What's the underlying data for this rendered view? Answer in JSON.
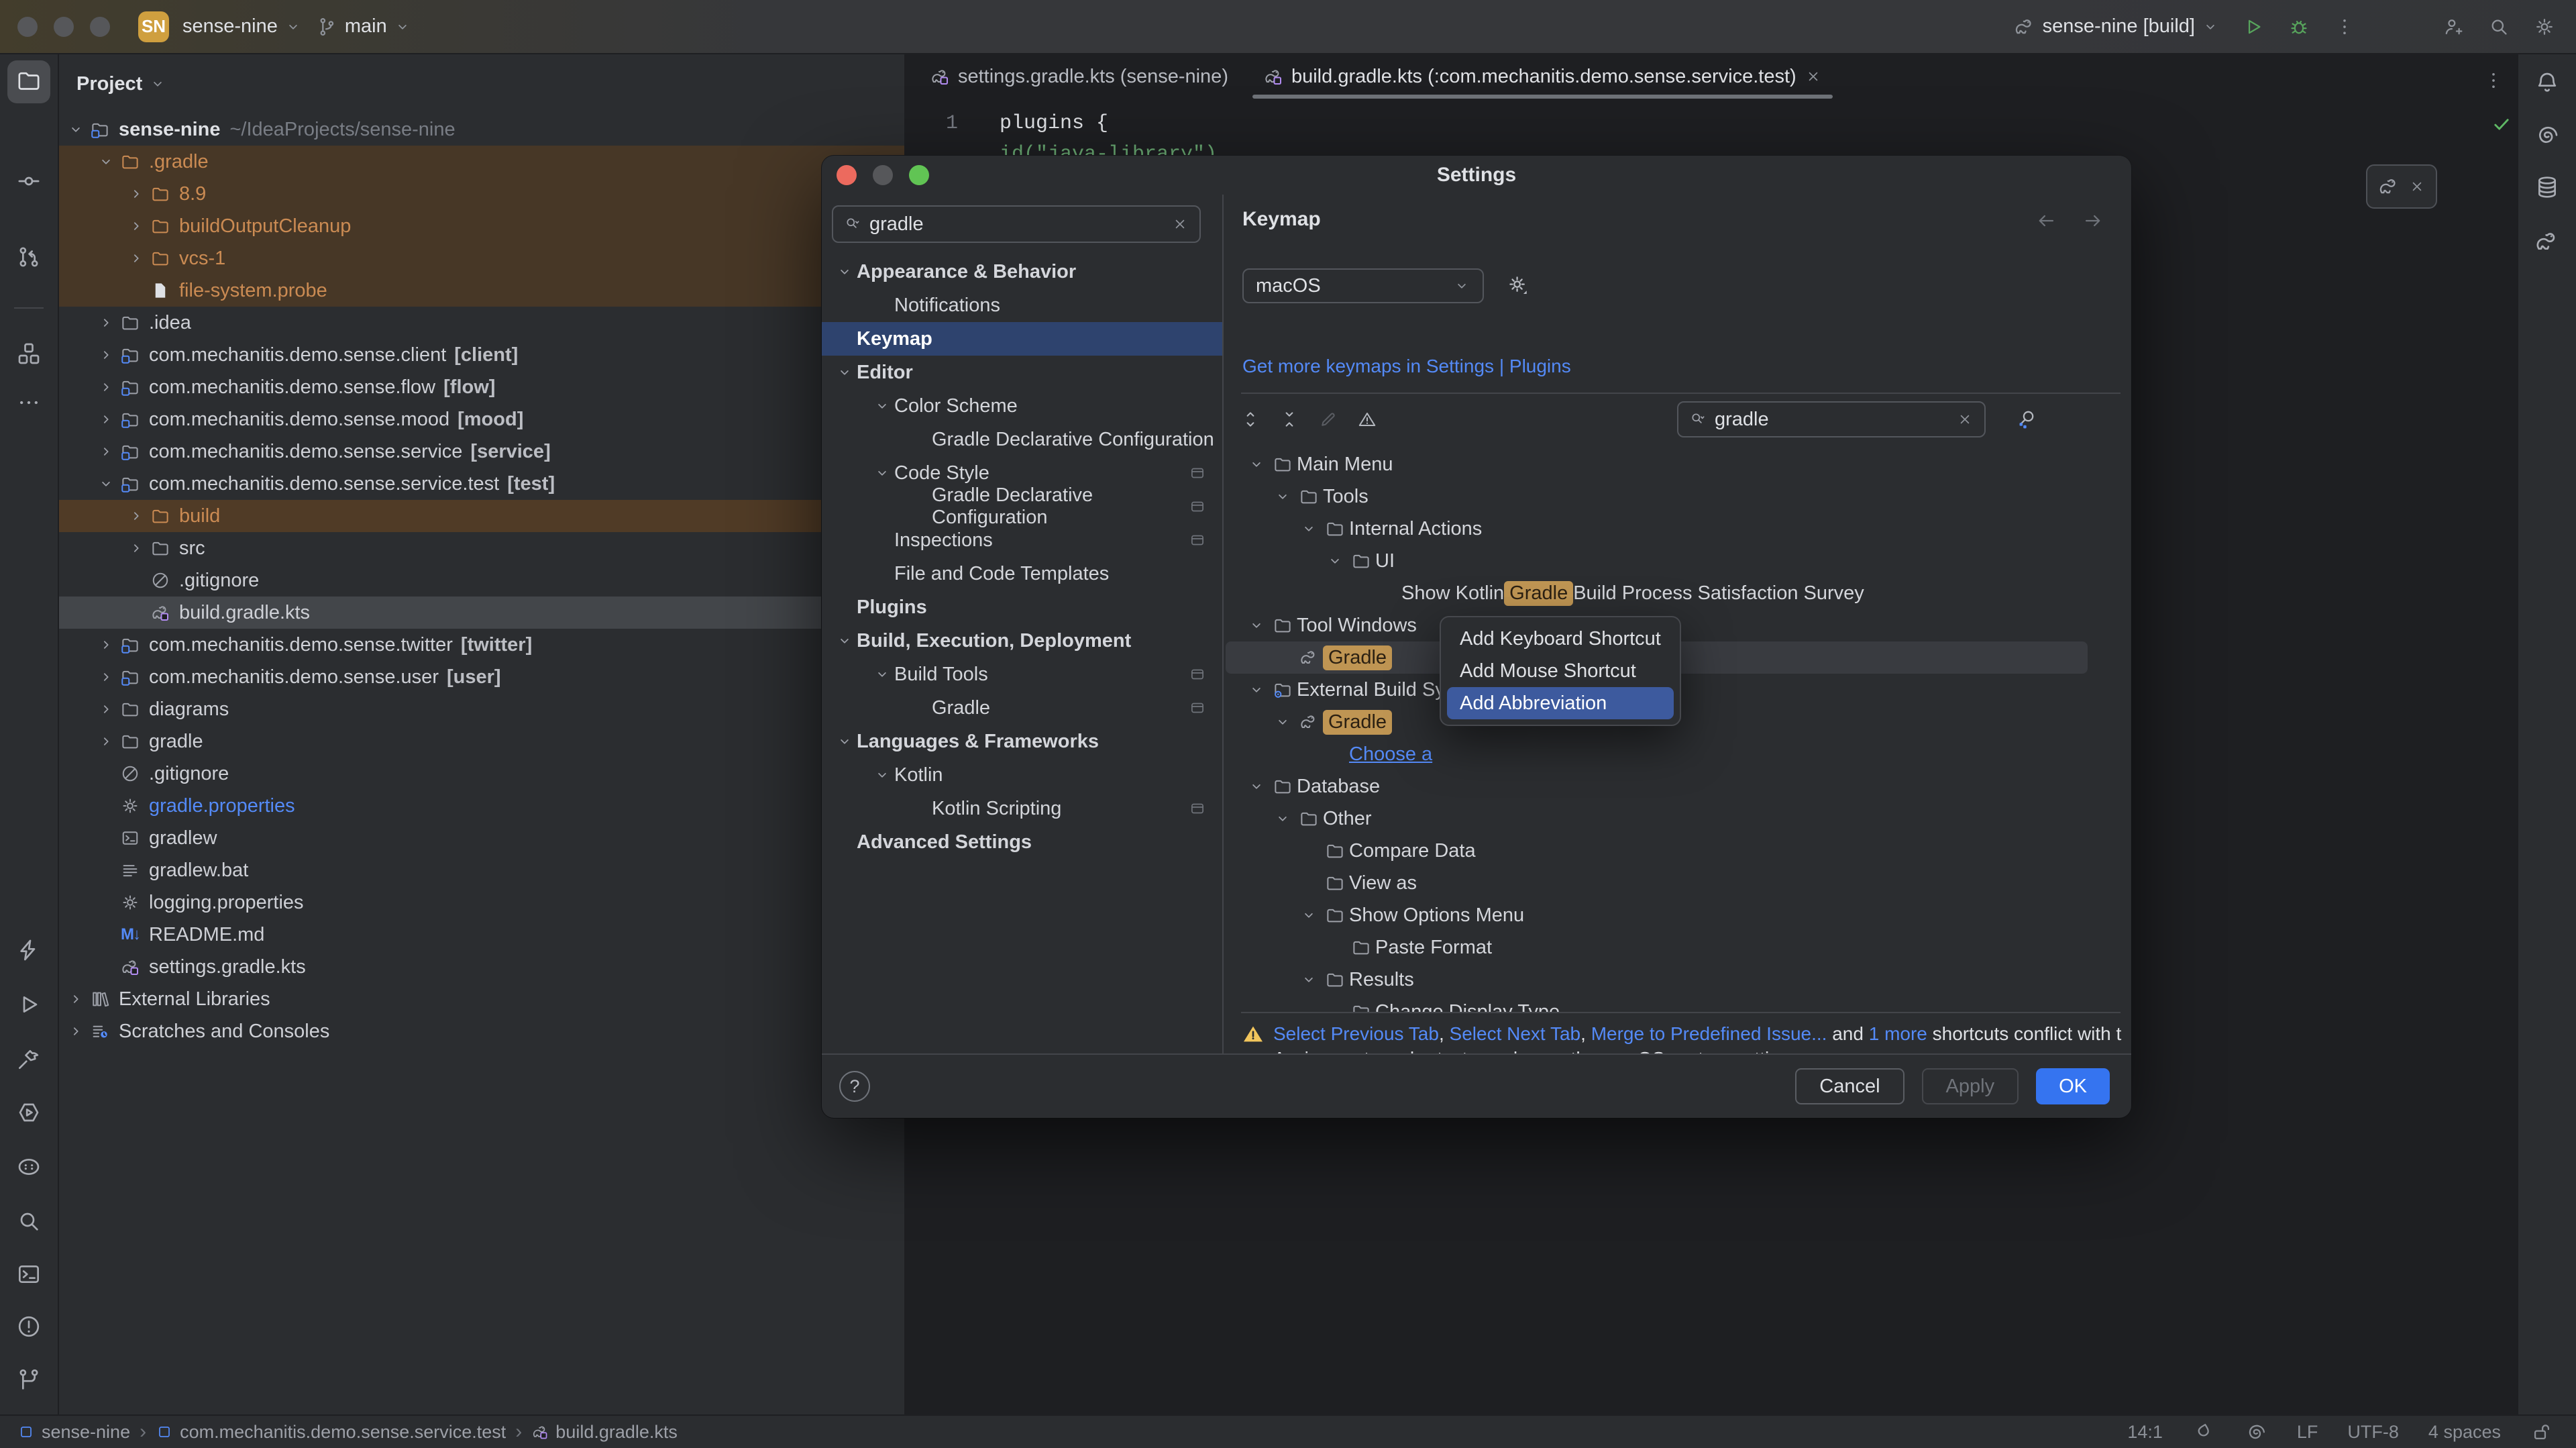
{
  "colors": {
    "accent": "#3574f0",
    "link": "#548af7",
    "selection_blue": "#2e436e",
    "menu_selection": "#3d5a9e",
    "match_amber": "#bf9553",
    "warning_yellow": "#f2c55c",
    "orange_file": "#cb8b53"
  },
  "titlebar": {
    "project_chip": "SN",
    "project_name": "sense-nine",
    "branch_name": "main",
    "run_config": "sense-nine [build]"
  },
  "project_panel": {
    "title": "Project",
    "rows": [
      {
        "level": 0,
        "chevron": "open",
        "icon": "module",
        "label": "sense-nine",
        "bold": true,
        "annotation": "~/IdeaProjects/sense-nine",
        "annotation_style": "path"
      },
      {
        "level": 1,
        "chevron": "open",
        "icon": "folder",
        "label": ".gradle",
        "color": "orange",
        "bg": "amber"
      },
      {
        "level": 2,
        "chevron": "closed",
        "icon": "folder",
        "label": "8.9",
        "color": "orange",
        "bg": "amber"
      },
      {
        "level": 2,
        "chevron": "closed",
        "icon": "folder",
        "label": "buildOutputCleanup",
        "color": "orange",
        "bg": "amber"
      },
      {
        "level": 2,
        "chevron": "closed",
        "icon": "folder",
        "label": "vcs-1",
        "color": "orange",
        "bg": "amber"
      },
      {
        "level": 2,
        "chevron": null,
        "icon": "file",
        "label": "file-system.probe",
        "color": "orange",
        "bg": "amber"
      },
      {
        "level": 1,
        "chevron": "closed",
        "icon": "folder",
        "label": ".idea"
      },
      {
        "level": 1,
        "chevron": "closed",
        "icon": "module",
        "label": "com.mechanitis.demo.sense.client",
        "annotation": "[client]",
        "annotation_style": "mod"
      },
      {
        "level": 1,
        "chevron": "closed",
        "icon": "module",
        "label": "com.mechanitis.demo.sense.flow",
        "annotation": "[flow]",
        "annotation_style": "mod"
      },
      {
        "level": 1,
        "chevron": "closed",
        "icon": "module",
        "label": "com.mechanitis.demo.sense.mood",
        "annotation": "[mood]",
        "annotation_style": "mod"
      },
      {
        "level": 1,
        "chevron": "closed",
        "icon": "module",
        "label": "com.mechanitis.demo.sense.service",
        "annotation": "[service]",
        "annotation_style": "mod"
      },
      {
        "level": 1,
        "chevron": "open",
        "icon": "module",
        "label": "com.mechanitis.demo.sense.service.test",
        "annotation": "[test]",
        "annotation_style": "mod"
      },
      {
        "level": 2,
        "chevron": "closed",
        "icon": "folder",
        "label": "build",
        "color": "orange",
        "bg": "amber2"
      },
      {
        "level": 2,
        "chevron": "closed",
        "icon": "folder",
        "label": "src"
      },
      {
        "level": 2,
        "chevron": null,
        "icon": "ignored",
        "label": ".gitignore"
      },
      {
        "level": 2,
        "chevron": null,
        "icon": "gradleFile",
        "label": "build.gradle.kts",
        "bg": "selected"
      },
      {
        "level": 1,
        "chevron": "closed",
        "icon": "module",
        "label": "com.mechanitis.demo.sense.twitter",
        "annotation": "[twitter]",
        "annotation_style": "mod"
      },
      {
        "level": 1,
        "chevron": "closed",
        "icon": "module",
        "label": "com.mechanitis.demo.sense.user",
        "annotation": "[user]",
        "annotation_style": "mod"
      },
      {
        "level": 1,
        "chevron": "closed",
        "icon": "folder",
        "label": "diagrams"
      },
      {
        "level": 1,
        "chevron": "closed",
        "icon": "folder",
        "label": "gradle"
      },
      {
        "level": 1,
        "chevron": null,
        "icon": "ignored",
        "label": ".gitignore"
      },
      {
        "level": 1,
        "chevron": null,
        "icon": "gear",
        "label": "gradle.properties",
        "color": "blue"
      },
      {
        "level": 1,
        "chevron": null,
        "icon": "shFile",
        "label": "gradlew"
      },
      {
        "level": 1,
        "chevron": null,
        "icon": "batFile",
        "label": "gradlew.bat"
      },
      {
        "level": 1,
        "chevron": null,
        "icon": "gear",
        "label": "logging.properties"
      },
      {
        "level": 1,
        "chevron": null,
        "icon": "md",
        "label": "README.md"
      },
      {
        "level": 1,
        "chevron": null,
        "icon": "gradleFile",
        "label": "settings.gradle.kts"
      },
      {
        "level": 0,
        "chevron": "closed",
        "icon": "libs",
        "label": "External Libraries"
      },
      {
        "level": 0,
        "chevron": "closed",
        "icon": "scratches",
        "label": "Scratches and Consoles"
      }
    ]
  },
  "editor": {
    "tabs": [
      {
        "label": "settings.gradle.kts (sense-nine)",
        "active": false,
        "closable": false
      },
      {
        "label": "build.gradle.kts (:com.mechanitis.demo.sense.service.test)",
        "active": true,
        "closable": true
      }
    ],
    "line1_number": "1",
    "line1_code": "plugins {",
    "line2_code": "    id(\"java-library\")"
  },
  "settings_dialog": {
    "title": "Settings",
    "search_value": "gradle",
    "nav": [
      {
        "level": 0,
        "chevron": "open",
        "label": "Appearance & Behavior",
        "bold": true
      },
      {
        "level": 1,
        "chevron": null,
        "label": "Notifications"
      },
      {
        "level": 0,
        "chevron": null,
        "label": "Keymap",
        "bold": true,
        "selected": true
      },
      {
        "level": 0,
        "chevron": "open",
        "label": "Editor",
        "bold": true
      },
      {
        "level": 1,
        "chevron": "open",
        "label": "Color Scheme"
      },
      {
        "level": 2,
        "chevron": null,
        "label": "Gradle Declarative Configuration"
      },
      {
        "level": 1,
        "chevron": "open",
        "label": "Code Style",
        "trailing": true
      },
      {
        "level": 2,
        "chevron": null,
        "label": "Gradle Declarative Configuration",
        "trailing": true
      },
      {
        "level": 1,
        "chevron": null,
        "label": "Inspections",
        "trailing": true
      },
      {
        "level": 1,
        "chevron": null,
        "label": "File and Code Templates"
      },
      {
        "level": 0,
        "chevron": null,
        "label": "Plugins",
        "bold": true
      },
      {
        "level": 0,
        "chevron": "open",
        "label": "Build, Execution, Deployment",
        "bold": true
      },
      {
        "level": 1,
        "chevron": "open",
        "label": "Build Tools",
        "trailing": true
      },
      {
        "level": 2,
        "chevron": null,
        "label": "Gradle",
        "trailing": true
      },
      {
        "level": 0,
        "chevron": "open",
        "label": "Languages & Frameworks",
        "bold": true
      },
      {
        "level": 1,
        "chevron": "open",
        "label": "Kotlin"
      },
      {
        "level": 2,
        "chevron": null,
        "label": "Kotlin Scripting",
        "trailing": true
      },
      {
        "level": 0,
        "chevron": null,
        "label": "Advanced Settings",
        "bold": true
      }
    ],
    "keymap": {
      "header": "Keymap",
      "scheme": "macOS",
      "links": {
        "more": "Get more keymaps in Settings",
        "divider": "|",
        "plugins": "Plugins"
      },
      "search_value": "gradle",
      "tree": [
        {
          "level": 0,
          "chevron": "open",
          "icon": "folder",
          "segments": [
            {
              "t": "Main Menu"
            }
          ]
        },
        {
          "level": 1,
          "chevron": "open",
          "icon": "folder",
          "segments": [
            {
              "t": "Tools"
            }
          ]
        },
        {
          "level": 2,
          "chevron": "open",
          "icon": "folder",
          "segments": [
            {
              "t": "Internal Actions"
            }
          ]
        },
        {
          "level": 3,
          "chevron": "open",
          "icon": "folder",
          "segments": [
            {
              "t": "UI"
            }
          ]
        },
        {
          "level": 4,
          "chevron": null,
          "icon": null,
          "segments": [
            {
              "t": "Show Kotlin "
            },
            {
              "t": "Gradle",
              "match": true
            },
            {
              "t": " Build Process Satisfaction Survey"
            }
          ]
        },
        {
          "level": 0,
          "chevron": "open",
          "icon": "folder",
          "segments": [
            {
              "t": "Tool Windows"
            }
          ]
        },
        {
          "level": 1,
          "chevron": null,
          "icon": "gradle",
          "segments": [
            {
              "t": "Gradle",
              "match": true
            }
          ],
          "selected": true
        },
        {
          "level": 0,
          "chevron": "open",
          "icon": "folderGear",
          "segments": [
            {
              "t": "External Build System"
            }
          ]
        },
        {
          "level": 1,
          "chevron": "open",
          "icon": "gradle",
          "segments": [
            {
              "t": "Gradle",
              "match": true
            }
          ]
        },
        {
          "level": 2,
          "chevron": null,
          "icon": null,
          "segments": [
            {
              "t": "Choose a ",
              "link": true
            }
          ]
        },
        {
          "level": 0,
          "chevron": "open",
          "icon": "folder",
          "segments": [
            {
              "t": "Database"
            }
          ]
        },
        {
          "level": 1,
          "chevron": "open",
          "icon": "folder",
          "segments": [
            {
              "t": "Other"
            }
          ]
        },
        {
          "level": 2,
          "chevron": null,
          "icon": "folder",
          "segments": [
            {
              "t": "Compare Data"
            }
          ]
        },
        {
          "level": 2,
          "chevron": null,
          "icon": "folder",
          "segments": [
            {
              "t": "View as"
            }
          ]
        },
        {
          "level": 2,
          "chevron": "open",
          "icon": "folder",
          "segments": [
            {
              "t": "Show Options Menu"
            }
          ]
        },
        {
          "level": 3,
          "chevron": null,
          "icon": "folder",
          "segments": [
            {
              "t": "Paste Format"
            }
          ]
        },
        {
          "level": 2,
          "chevron": "open",
          "icon": "folder",
          "segments": [
            {
              "t": "Results"
            }
          ]
        },
        {
          "level": 3,
          "chevron": null,
          "icon": "folder",
          "segments": [
            {
              "t": "Change Display Type"
            }
          ]
        }
      ],
      "warning": {
        "line1": [
          {
            "t": "Select Previous Tab",
            "link": true
          },
          {
            "t": ", "
          },
          {
            "t": "Select Next Tab",
            "link": true
          },
          {
            "t": ", "
          },
          {
            "t": "Merge to Predefined Issue...",
            "link": true
          },
          {
            "t": " and "
          },
          {
            "t": "1 more",
            "link": true
          },
          {
            "t": " shortcuts conflict with t"
          }
        ],
        "line2": "Assign custom shortcuts or change the macOS system settings."
      }
    },
    "buttons": {
      "cancel": "Cancel",
      "apply": "Apply",
      "ok": "OK"
    },
    "help_label": "?"
  },
  "context_menu": {
    "items": [
      {
        "label": "Add Keyboard Shortcut",
        "selected": false
      },
      {
        "label": "Add Mouse Shortcut",
        "selected": false
      },
      {
        "label": "Add Abbreviation",
        "selected": true
      }
    ]
  },
  "status_bar": {
    "breadcrumbs": [
      {
        "icon": "moduleSq",
        "label": "sense-nine"
      },
      {
        "icon": "moduleSq",
        "label": "com.mechanitis.demo.sense.service.test"
      },
      {
        "icon": "gradleFile",
        "label": "build.gradle.kts"
      }
    ],
    "position": "14:1",
    "line_ending": "LF",
    "encoding": "UTF-8",
    "indent": "4 spaces"
  }
}
